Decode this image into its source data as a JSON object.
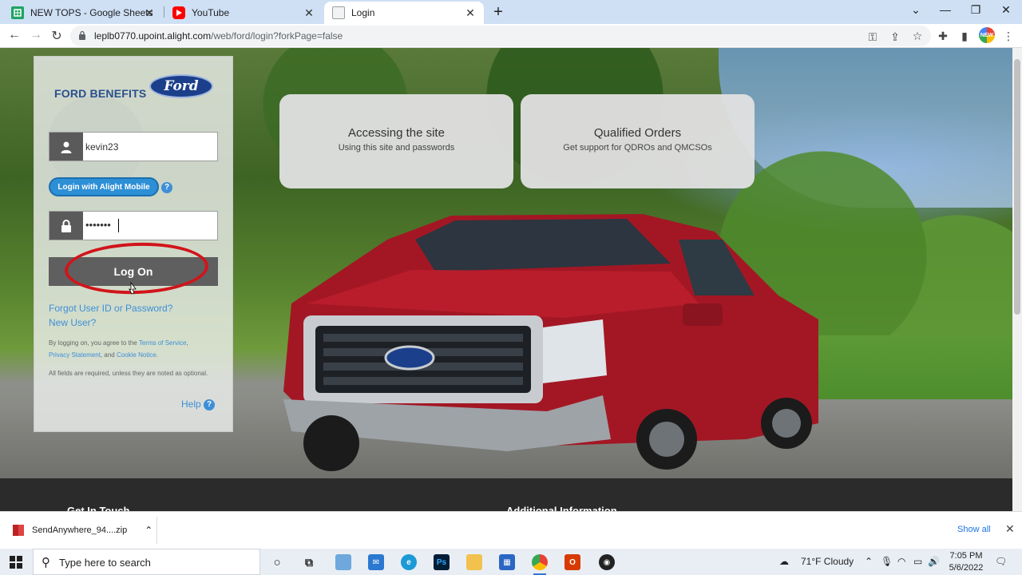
{
  "browser": {
    "tabs": [
      {
        "label": "NEW TOPS - Google Sheets",
        "icon": "google-sheets-icon"
      },
      {
        "label": "YouTube",
        "icon": "youtube-icon"
      },
      {
        "label": "Login",
        "icon": "page-icon",
        "active": true
      }
    ],
    "url_host": "leplb0770.upoint.alight.com",
    "url_path": "/web/ford/login?forkPage=false",
    "profile_initials": "NEW"
  },
  "login": {
    "brand": "FORD BENEFITS",
    "logo_text": "Ford",
    "username_value": "kevin23",
    "password_value": "•••••••",
    "mobile_button": "Login with Alight Mobile",
    "help_q": "?",
    "logon_button": "Log On",
    "forgot_link": "Forgot User ID or Password?",
    "new_user_link": "New User?",
    "terms_prefix": "By logging on, you agree to the ",
    "terms_link": "Terms of Service",
    "terms_comma": ",",
    "privacy_link": "Privacy Statement",
    "terms_and": ", and ",
    "cookie_link": "Cookie Notice",
    "terms_period": ".",
    "required_note": "All fields are required, unless they are noted as optional.",
    "help_label": "Help"
  },
  "cards": [
    {
      "title": "Accessing the site",
      "subtitle": "Using this site and passwords"
    },
    {
      "title": "Qualified Orders",
      "subtitle": "Get support for QDROs and QMCSOs"
    }
  ],
  "footer": {
    "left_heading": "Get In Touch",
    "right_heading": "Additional Information"
  },
  "downloads": {
    "file": "SendAnywhere_94....zip",
    "show_all": "Show all"
  },
  "taskbar": {
    "search_placeholder": "Type here to search",
    "weather": "71°F  Cloudy",
    "time": "7:05 PM",
    "date": "5/6/2022"
  }
}
